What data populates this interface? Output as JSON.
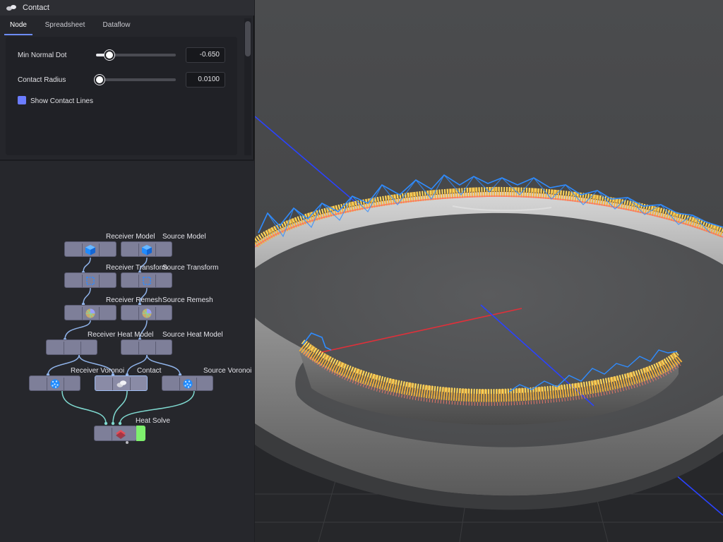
{
  "window": {
    "title": "Contact",
    "icon": "contact-node-icon"
  },
  "tabs": [
    {
      "label": "Node",
      "active": true
    },
    {
      "label": "Spreadsheet",
      "active": false
    },
    {
      "label": "Dataflow",
      "active": false
    }
  ],
  "properties": {
    "min_normal_dot": {
      "label": "Min Normal Dot",
      "value": "-0.650",
      "slider_fraction": 0.17
    },
    "contact_radius": {
      "label": "Contact Radius",
      "value": "0.0100",
      "slider_fraction": 0.0
    },
    "show_contact_lines": {
      "label": "Show Contact Lines",
      "checked": true
    }
  },
  "graph": {
    "nodes": {
      "receiver_model": "Receiver Model",
      "source_model": "Source Model",
      "receiver_transform": "Receiver Transform",
      "source_transform": "Source Transform",
      "receiver_remesh": "Receiver Remesh",
      "source_remesh": "Source Remesh",
      "receiver_heat_model": "Receiver Heat Model",
      "source_heat_model": "Source Heat Model",
      "receiver_voronoi": "Receiver Voronoi",
      "contact": "Contact",
      "source_voronoi": "Source Voronoi",
      "heat_solve": "Heat Solve"
    }
  },
  "colors": {
    "accent": "#6b7cff",
    "node_fill": "#7e7f99",
    "selection_outline": "#9fbdf3",
    "wire": "#7fd9d0",
    "contact_lines": "#2f8cff",
    "contact_points": "#ffd84a",
    "active_output": "#7ef06d"
  }
}
